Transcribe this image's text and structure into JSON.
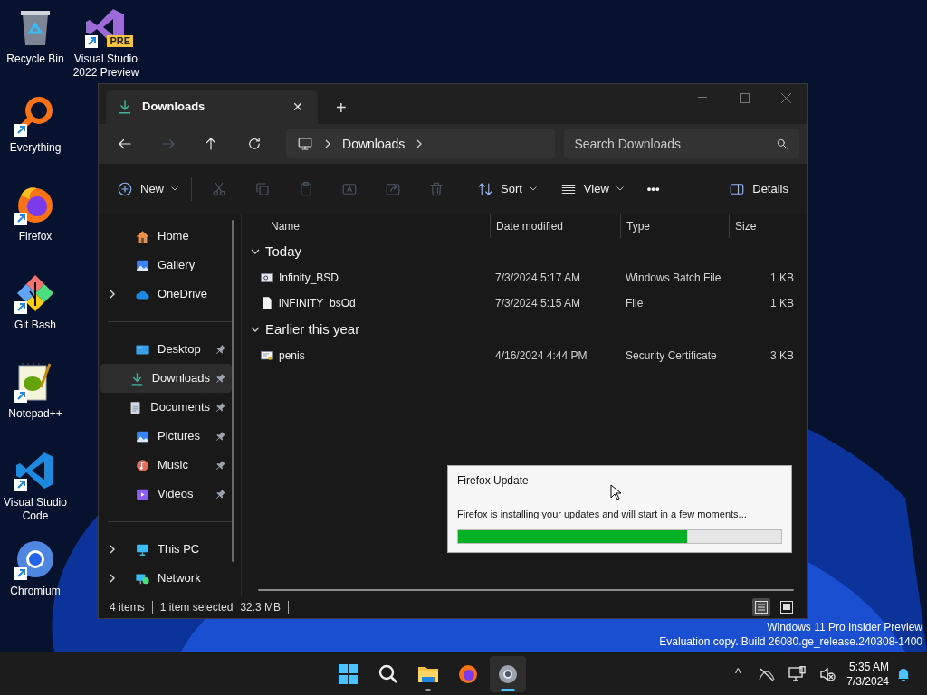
{
  "desktop_icons": [
    {
      "kind": "recycle_bin",
      "label": "Recycle Bin",
      "shortcut": false
    },
    {
      "kind": "everything",
      "label": "Everything",
      "shortcut": true
    },
    {
      "kind": "firefox",
      "label": "Firefox",
      "shortcut": true
    },
    {
      "kind": "git",
      "label": "Git Bash",
      "shortcut": true
    },
    {
      "kind": "notepad",
      "label": "Notepad++",
      "shortcut": true
    },
    {
      "kind": "vscode",
      "label": "Visual Studio Code",
      "shortcut": true
    },
    {
      "kind": "chromium",
      "label": "Chromium",
      "shortcut": true
    },
    {
      "kind": "visual_studio",
      "label": "Visual Studio 2022 Preview",
      "shortcut": true,
      "badge": "PRE"
    }
  ],
  "explorer": {
    "tab": {
      "title": "Downloads",
      "selected": true,
      "close": "✕",
      "new_tab": "+"
    },
    "nav": [
      {
        "kind": "back",
        "disabled": false
      },
      {
        "kind": "forward",
        "disabled": true
      },
      {
        "kind": "up",
        "disabled": false
      },
      {
        "kind": "refresh",
        "disabled": false
      }
    ],
    "breadcrumb": [
      "Downloads"
    ],
    "search": {
      "placeholder": "Search Downloads"
    },
    "toolbar": {
      "new": "New",
      "tools": [
        {
          "kind": "cut",
          "disabled": true
        },
        {
          "kind": "copy",
          "disabled": true
        },
        {
          "kind": "paste",
          "disabled": true
        },
        {
          "kind": "rename",
          "disabled": true
        },
        {
          "kind": "share",
          "disabled": true
        },
        {
          "kind": "delete",
          "disabled": true
        }
      ],
      "sort": "Sort",
      "view": "View",
      "more": "•••",
      "details": "Details"
    },
    "sidebar": [
      [
        {
          "label": "Home",
          "kind": "home",
          "expandable": false,
          "pinned": false,
          "selected": false
        },
        {
          "label": "Gallery",
          "kind": "gallery",
          "expandable": false,
          "pinned": false,
          "selected": false
        },
        {
          "label": "OneDrive",
          "kind": "cloud",
          "expandable": true,
          "pinned": false,
          "selected": false
        }
      ],
      [
        {
          "label": "Desktop",
          "kind": "desktop",
          "expandable": false,
          "pinned": true,
          "selected": false
        },
        {
          "label": "Downloads",
          "kind": "download",
          "expandable": false,
          "pinned": true,
          "selected": true
        },
        {
          "label": "Documents",
          "kind": "documents",
          "expandable": false,
          "pinned": true,
          "selected": false
        },
        {
          "label": "Pictures",
          "kind": "gallery",
          "expandable": false,
          "pinned": true,
          "selected": false
        },
        {
          "label": "Music",
          "kind": "music",
          "expandable": false,
          "pinned": true,
          "selected": false
        },
        {
          "label": "Videos",
          "kind": "videos",
          "expandable": false,
          "pinned": true,
          "selected": false
        }
      ],
      [
        {
          "label": "This PC",
          "kind": "pc",
          "expandable": true,
          "pinned": false,
          "selected": false
        },
        {
          "label": "Network",
          "kind": "network",
          "expandable": true,
          "pinned": false,
          "selected": false
        }
      ]
    ],
    "columns": [
      "Name",
      "Date modified",
      "Type",
      "Size"
    ],
    "groups": [
      {
        "label": "Today",
        "expanded": true,
        "files": [
          {
            "kind": "batch",
            "name": "Infinity_BSD",
            "date": "7/3/2024 5:17 AM",
            "type": "Windows Batch File",
            "size": "1 KB"
          },
          {
            "kind": "file",
            "name": "iNFINITY_bsOd",
            "date": "7/3/2024 5:15 AM",
            "type": "File",
            "size": "1 KB"
          }
        ]
      },
      {
        "label": "Earlier this year",
        "expanded": true,
        "files": [
          {
            "kind": "certificate",
            "name": "penis",
            "date": "4/16/2024 4:44 PM",
            "type": "Security Certificate",
            "size": "3 KB"
          }
        ]
      }
    ],
    "status": {
      "count": "4 items",
      "selection": "1 item selected",
      "size": "32.3 MB"
    },
    "views": [
      {
        "kind": "details",
        "selected": true
      },
      {
        "kind": "tiles",
        "selected": false
      }
    ]
  },
  "update_dialog": {
    "title": "Firefox Update",
    "message": "Firefox is installing your updates and will start in a few moments...",
    "level": 0.71
  },
  "watermark": [
    "Windows 11 Pro Insider Preview",
    "Evaluation copy. Build 26080.ge_release.240308-1400"
  ],
  "taskbar": {
    "apps": [
      {
        "kind": "start",
        "running": false,
        "active": false
      },
      {
        "kind": "search",
        "running": false,
        "active": false
      },
      {
        "kind": "explorer",
        "running": true,
        "active": false
      },
      {
        "kind": "firefox",
        "running": false,
        "active": false
      },
      {
        "kind": "chromium",
        "running": true,
        "active": true
      }
    ],
    "tray": {
      "overflow": "^",
      "time": "5:35 AM",
      "date": "7/3/2024"
    }
  }
}
